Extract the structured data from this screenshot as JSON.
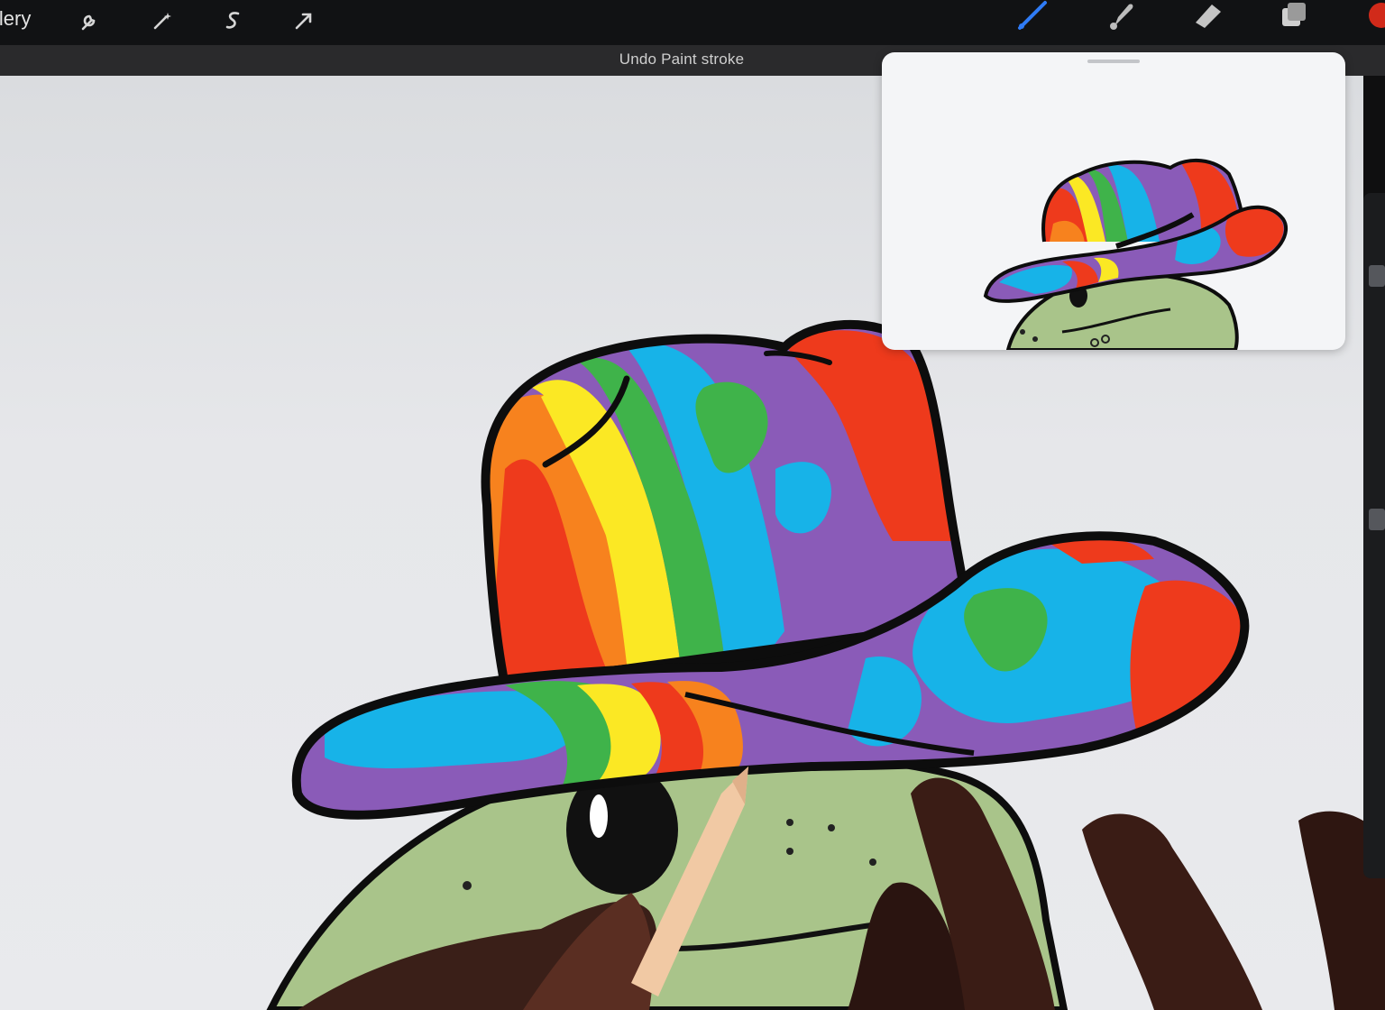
{
  "toolbar": {
    "gallery_label": "llery",
    "left_icons": [
      "wrench-icon",
      "magic-wand-icon",
      "selection-icon",
      "transform-arrow-icon"
    ],
    "right_icons": [
      "brush-icon",
      "smudge-icon",
      "eraser-icon",
      "layers-icon",
      "color-swatch-icon"
    ],
    "accent_color": "#2f7bf5",
    "color_swatch": "#d12a1a"
  },
  "status": {
    "message": "Undo Paint stroke"
  },
  "reference_window": {
    "icon": "reference-image"
  },
  "colors": {
    "hat_red": "#ee3a1c",
    "hat_orange": "#f7821e",
    "hat_yellow": "#fbe824",
    "hat_green": "#3fb34a",
    "hat_blue": "#17b3e8",
    "hat_purple": "#8a5bb8",
    "frog_green": "#a9c48a",
    "outline": "#0d0d0d"
  }
}
